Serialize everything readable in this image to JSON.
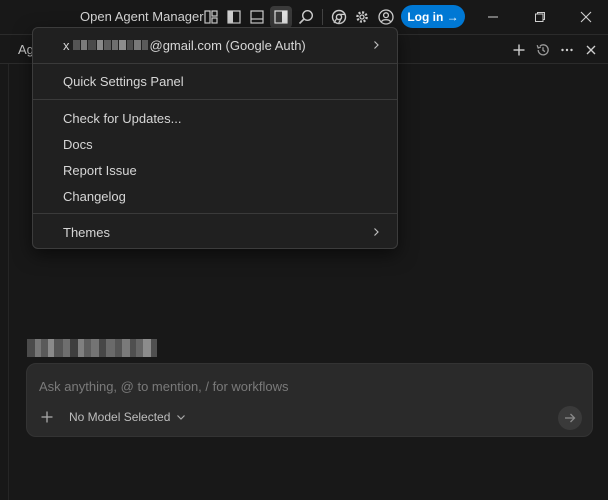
{
  "titlebar": {
    "title": "Open Agent Manager",
    "login_label": "Log in →",
    "icons": [
      "layout-icon",
      "toggle-primary-sidebar-icon",
      "toggle-panel-icon",
      "toggle-secondary-sidebar-icon",
      "search-icon",
      "browser-icon",
      "settings-icon",
      "account-icon"
    ],
    "window_controls": [
      "minimize-icon",
      "restore-icon",
      "close-icon"
    ],
    "accent": "#0078d4"
  },
  "panel": {
    "tab_label": "Ag",
    "actions": [
      "plus-icon",
      "history-icon",
      "more-icon",
      "close-icon"
    ]
  },
  "menu": {
    "account_prefix": "x",
    "account_suffix": "@gmail.com (Google Auth)",
    "items": {
      "quick_settings": "Quick Settings Panel",
      "check_updates": "Check for Updates...",
      "docs": "Docs",
      "report_issue": "Report Issue",
      "changelog": "Changelog",
      "themes": "Themes"
    }
  },
  "chat": {
    "placeholder": "Ask anything, @ to mention, / for workflows",
    "model_label": "No Model Selected"
  },
  "colors": {
    "background": "#181818",
    "menu_bg": "#202020",
    "input_bg": "#2a2a2a"
  }
}
